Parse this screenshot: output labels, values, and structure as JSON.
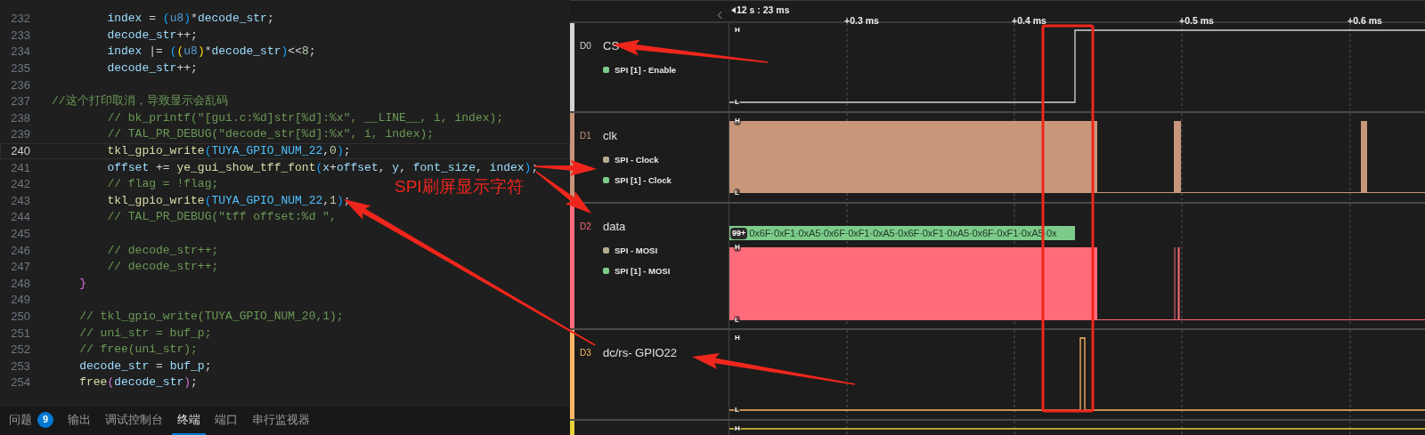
{
  "editor": {
    "lines": [
      {
        "number": "232",
        "active": false,
        "segments": [
          {
            "text": "        index",
            "kind": "var"
          },
          {
            "text": " = ",
            "kind": "plain"
          },
          {
            "text": "(",
            "kind": "bracket-blue"
          },
          {
            "text": "u8",
            "kind": "type"
          },
          {
            "text": ")",
            "kind": "bracket-blue"
          },
          {
            "text": "*",
            "kind": "plain"
          },
          {
            "text": "decode_str",
            "kind": "var"
          },
          {
            "text": ";",
            "kind": "plain"
          }
        ]
      },
      {
        "number": "233",
        "active": false,
        "segments": [
          {
            "text": "        decode_str",
            "kind": "var"
          },
          {
            "text": "++;",
            "kind": "plain"
          }
        ]
      },
      {
        "number": "234",
        "active": false,
        "segments": [
          {
            "text": "        index",
            "kind": "var"
          },
          {
            "text": " |= ",
            "kind": "plain"
          },
          {
            "text": "(",
            "kind": "bracket-blue"
          },
          {
            "text": "(",
            "kind": "bracket-gold"
          },
          {
            "text": "u8",
            "kind": "type"
          },
          {
            "text": ")",
            "kind": "bracket-gold"
          },
          {
            "text": "*",
            "kind": "plain"
          },
          {
            "text": "decode_str",
            "kind": "var"
          },
          {
            "text": ")",
            "kind": "bracket-blue"
          },
          {
            "text": "<<",
            "kind": "plain"
          },
          {
            "text": "8",
            "kind": "num"
          },
          {
            "text": ";",
            "kind": "plain"
          }
        ]
      },
      {
        "number": "235",
        "active": false,
        "segments": [
          {
            "text": "        decode_str",
            "kind": "var"
          },
          {
            "text": "++;",
            "kind": "plain"
          }
        ]
      },
      {
        "number": "236",
        "active": false
      },
      {
        "number": "237",
        "active": false,
        "segments": [
          {
            "text": "//这个打印取消，导致显示会乱码",
            "kind": "comment"
          }
        ]
      },
      {
        "number": "238",
        "active": false,
        "segments": [
          {
            "text": "        // bk_printf(\"[gui.c:%d]str[%d]:%x\", __LINE__, i, index);",
            "kind": "comment"
          }
        ]
      },
      {
        "number": "239",
        "active": false,
        "segments": [
          {
            "text": "        // TAL_PR_DEBUG(\"decode_str[%d]:%x\", i, index);",
            "kind": "comment"
          }
        ]
      },
      {
        "number": "240",
        "active": true,
        "segments": [
          {
            "text": "        tkl_gpio_write",
            "kind": "func"
          },
          {
            "text": "(",
            "kind": "bracket-blue"
          },
          {
            "text": "TUYA_GPIO_NUM_22",
            "kind": "const"
          },
          {
            "text": ",",
            "kind": "plain"
          },
          {
            "text": "0",
            "kind": "num"
          },
          {
            "text": ")",
            "kind": "bracket-blue"
          },
          {
            "text": ";",
            "kind": "plain"
          }
        ]
      },
      {
        "number": "241",
        "active": false,
        "segments": [
          {
            "text": "        offset",
            "kind": "var"
          },
          {
            "text": " += ",
            "kind": "plain"
          },
          {
            "text": "ye_gui_show_tff_font",
            "kind": "func"
          },
          {
            "text": "(",
            "kind": "bracket-blue"
          },
          {
            "text": "x",
            "kind": "var"
          },
          {
            "text": "+",
            "kind": "plain"
          },
          {
            "text": "offset",
            "kind": "var"
          },
          {
            "text": ", ",
            "kind": "plain"
          },
          {
            "text": "y",
            "kind": "var"
          },
          {
            "text": ", ",
            "kind": "plain"
          },
          {
            "text": "font_size",
            "kind": "var"
          },
          {
            "text": ", ",
            "kind": "plain"
          },
          {
            "text": "index",
            "kind": "var"
          },
          {
            "text": ")",
            "kind": "bracket-blue"
          },
          {
            "text": ";",
            "kind": "plain"
          }
        ]
      },
      {
        "number": "242",
        "active": false,
        "segments": [
          {
            "text": "        // flag = !flag;",
            "kind": "comment"
          }
        ]
      },
      {
        "number": "243",
        "active": false,
        "segments": [
          {
            "text": "        tkl_gpio_write",
            "kind": "func"
          },
          {
            "text": "(",
            "kind": "bracket-blue"
          },
          {
            "text": "TUYA_GPIO_NUM_22",
            "kind": "const"
          },
          {
            "text": ",",
            "kind": "plain"
          },
          {
            "text": "1",
            "kind": "num"
          },
          {
            "text": ")",
            "kind": "bracket-blue"
          },
          {
            "text": ";",
            "kind": "plain"
          }
        ]
      },
      {
        "number": "244",
        "active": false,
        "segments": [
          {
            "text": "        // TAL_PR_DEBUG(\"tff offset:%d \", ",
            "kind": "comment"
          }
        ]
      },
      {
        "number": "245",
        "active": false
      },
      {
        "number": "246",
        "active": false,
        "segments": [
          {
            "text": "        // decode_str++;",
            "kind": "comment"
          }
        ]
      },
      {
        "number": "247",
        "active": false,
        "segments": [
          {
            "text": "        // decode_str++;",
            "kind": "comment"
          }
        ]
      },
      {
        "number": "248",
        "active": false,
        "segments": [
          {
            "text": "    }",
            "kind": "bracket-pink"
          }
        ]
      },
      {
        "number": "249",
        "active": false
      },
      {
        "number": "250",
        "active": false,
        "segments": [
          {
            "text": "    // tkl_gpio_write(TUYA_GPIO_NUM_20,1);",
            "kind": "comment"
          }
        ]
      },
      {
        "number": "251",
        "active": false,
        "segments": [
          {
            "text": "    // uni_str = buf_p;",
            "kind": "comment"
          }
        ]
      },
      {
        "number": "252",
        "active": false,
        "segments": [
          {
            "text": "    // free(uni_str);",
            "kind": "comment"
          }
        ]
      },
      {
        "number": "253",
        "active": false,
        "segments": [
          {
            "text": "    decode_str",
            "kind": "var"
          },
          {
            "text": " = ",
            "kind": "plain"
          },
          {
            "text": "buf_p",
            "kind": "var"
          },
          {
            "text": ";",
            "kind": "plain"
          }
        ]
      },
      {
        "number": "254",
        "active": false,
        "segments": [
          {
            "text": "    free",
            "kind": "func"
          },
          {
            "text": "(",
            "kind": "bracket-pink"
          },
          {
            "text": "decode_str",
            "kind": "var"
          },
          {
            "text": ")",
            "kind": "bracket-pink"
          },
          {
            "text": ";",
            "kind": "plain"
          }
        ]
      }
    ]
  },
  "panel_tabs": [
    {
      "label": "问题",
      "badge": "9",
      "selected": false
    },
    {
      "label": "输出",
      "selected": false
    },
    {
      "label": "调试控制台",
      "selected": false
    },
    {
      "label": "终端",
      "selected": true
    },
    {
      "label": "端口",
      "selected": false
    },
    {
      "label": "串行监视器",
      "selected": false
    }
  ],
  "analyzer": {
    "time_origin": "12 s : 23 ms",
    "ticks": [
      "+0.3 ms",
      "+0.4 ms",
      "+0.5 ms",
      "+0.6 ms"
    ],
    "channels": [
      {
        "id": "D0",
        "name": "CS",
        "kind": "cs",
        "color": "#d4d4d4",
        "high_label": "H",
        "low_label": "L",
        "legend": [
          {
            "label": "SPI [1] - Enable",
            "color": "#7dcb8a"
          }
        ]
      },
      {
        "id": "D1",
        "name": "clk",
        "kind": "clock",
        "color": "#c8967a",
        "high_label": "H",
        "low_label": "L",
        "legend": [
          {
            "label": "SPI - Clock",
            "color": "#b5ab8f"
          },
          {
            "label": "SPI [1] - Clock",
            "color": "#7dcb8a"
          }
        ]
      },
      {
        "id": "D2",
        "name": "data",
        "kind": "data",
        "color": "#ff6b7a",
        "high_label": "H",
        "low_label": "L",
        "decoded": {
          "badge": "99+",
          "text": "0x6F·0xF1·0xA5·0x6F·0xF1·0xA5·0x6F·0xF1·0xA5·0x6F·0xF1·0xA5·0x"
        },
        "legend": [
          {
            "label": "SPI - MOSI",
            "color": "#b5ab8f"
          },
          {
            "label": "SPI [1] - MOSI",
            "color": "#7dcb8a"
          }
        ]
      },
      {
        "id": "D3",
        "name": "dc/rs- GPIO22",
        "kind": "pulse",
        "color": "#ffb862",
        "high_label": "H",
        "low_label": "L"
      },
      {
        "kind": "level",
        "color": "#e8d33a",
        "high_label": "H"
      }
    ]
  },
  "annotation": {
    "label": "SPI刷屏显示字符"
  }
}
